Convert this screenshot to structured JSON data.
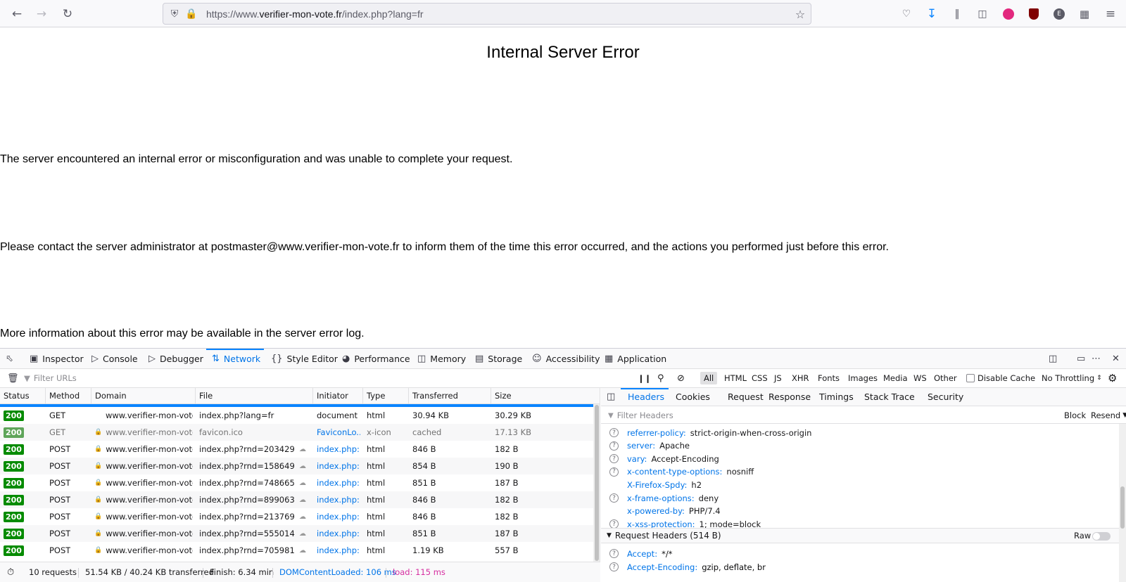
{
  "browser": {
    "url_prefix": "https://www.",
    "url_host": "verifier-mon-vote.fr",
    "url_path": "/index.php?lang=fr"
  },
  "page": {
    "title": "Internal Server Error",
    "p1": "The server encountered an internal error or misconfiguration and was unable to complete your request.",
    "p2": "Please contact the server administrator at postmaster@www.verifier-mon-vote.fr to inform them of the time this error occurred, and the actions you performed just before this error.",
    "p3": "More information about this error may be available in the server error log."
  },
  "devtools": {
    "tabs": [
      "Inspector",
      "Console",
      "Debugger",
      "Network",
      "Style Editor",
      "Performance",
      "Memory",
      "Storage",
      "Accessibility",
      "Application"
    ],
    "filter_placeholder": "Filter URLs",
    "type_filters": [
      "All",
      "HTML",
      "CSS",
      "JS",
      "XHR",
      "Fonts",
      "Images",
      "Media",
      "WS",
      "Other"
    ],
    "disable_cache": "Disable Cache",
    "throttling": "No Throttling",
    "columns": [
      "Status",
      "Method",
      "Domain",
      "File",
      "Initiator",
      "Type",
      "Transferred",
      "Size"
    ],
    "requests": [
      {
        "status": "200",
        "method": "GET",
        "domain": "www.verifier-mon-vote...",
        "file": "index.php?lang=fr",
        "initiator": "document",
        "type": "html",
        "transferred": "30.94 KB",
        "size": "30.29 KB"
      },
      {
        "status": "200",
        "method": "GET",
        "domain": "www.verifier-mon-vote...",
        "file": "favicon.ico",
        "initiator": "FaviconLo...",
        "type": "x-icon",
        "transferred": "cached",
        "size": "17.13 KB"
      },
      {
        "status": "200",
        "method": "POST",
        "domain": "www.verifier-mon-vote...",
        "file": "index.php?rnd=203429",
        "initiator": "index.php:...",
        "type": "html",
        "transferred": "846 B",
        "size": "182 B"
      },
      {
        "status": "200",
        "method": "POST",
        "domain": "www.verifier-mon-vote...",
        "file": "index.php?rnd=158649",
        "initiator": "index.php:...",
        "type": "html",
        "transferred": "854 B",
        "size": "190 B"
      },
      {
        "status": "200",
        "method": "POST",
        "domain": "www.verifier-mon-vote...",
        "file": "index.php?rnd=748665",
        "initiator": "index.php:...",
        "type": "html",
        "transferred": "851 B",
        "size": "187 B"
      },
      {
        "status": "200",
        "method": "POST",
        "domain": "www.verifier-mon-vote...",
        "file": "index.php?rnd=899063",
        "initiator": "index.php:...",
        "type": "html",
        "transferred": "846 B",
        "size": "182 B"
      },
      {
        "status": "200",
        "method": "POST",
        "domain": "www.verifier-mon-vote...",
        "file": "index.php?rnd=213769",
        "initiator": "index.php:...",
        "type": "html",
        "transferred": "846 B",
        "size": "182 B"
      },
      {
        "status": "200",
        "method": "POST",
        "domain": "www.verifier-mon-vote...",
        "file": "index.php?rnd=555014",
        "initiator": "index.php:...",
        "type": "html",
        "transferred": "851 B",
        "size": "187 B"
      },
      {
        "status": "200",
        "method": "POST",
        "domain": "www.verifier-mon-vote...",
        "file": "index.php?rnd=705981",
        "initiator": "index.php:...",
        "type": "html",
        "transferred": "1.19 KB",
        "size": "557 B"
      }
    ],
    "summary": {
      "requests": "10 requests",
      "transferred": "51.54 KB / 40.24 KB transferred",
      "finish": "Finish: 6.34 min",
      "dom": "DOMContentLoaded: 106 ms",
      "load": "load: 115 ms"
    },
    "side_tabs": [
      "Headers",
      "Cookies",
      "Request",
      "Response",
      "Timings",
      "Stack Trace",
      "Security"
    ],
    "filter_headers": "Filter Headers",
    "block": "Block",
    "resend": "Resend",
    "response_headers": [
      {
        "name": "referrer-policy:",
        "value": "strict-origin-when-cross-origin",
        "help": true
      },
      {
        "name": "server:",
        "value": "Apache",
        "help": true
      },
      {
        "name": "vary:",
        "value": "Accept-Encoding",
        "help": true
      },
      {
        "name": "x-content-type-options:",
        "value": "nosniff",
        "help": true
      },
      {
        "name": "X-Firefox-Spdy:",
        "value": "h2",
        "help": false
      },
      {
        "name": "x-frame-options:",
        "value": "deny",
        "help": true
      },
      {
        "name": "x-powered-by:",
        "value": "PHP/7.4",
        "help": false
      },
      {
        "name": "x-xss-protection:",
        "value": "1; mode=block",
        "help": true
      }
    ],
    "request_headers_title": "Request Headers (514 B)",
    "raw": "Raw",
    "request_headers": [
      {
        "name": "Accept:",
        "value": "*/*"
      },
      {
        "name": "Accept-Encoding:",
        "value": "gzip, deflate, br"
      }
    ]
  }
}
